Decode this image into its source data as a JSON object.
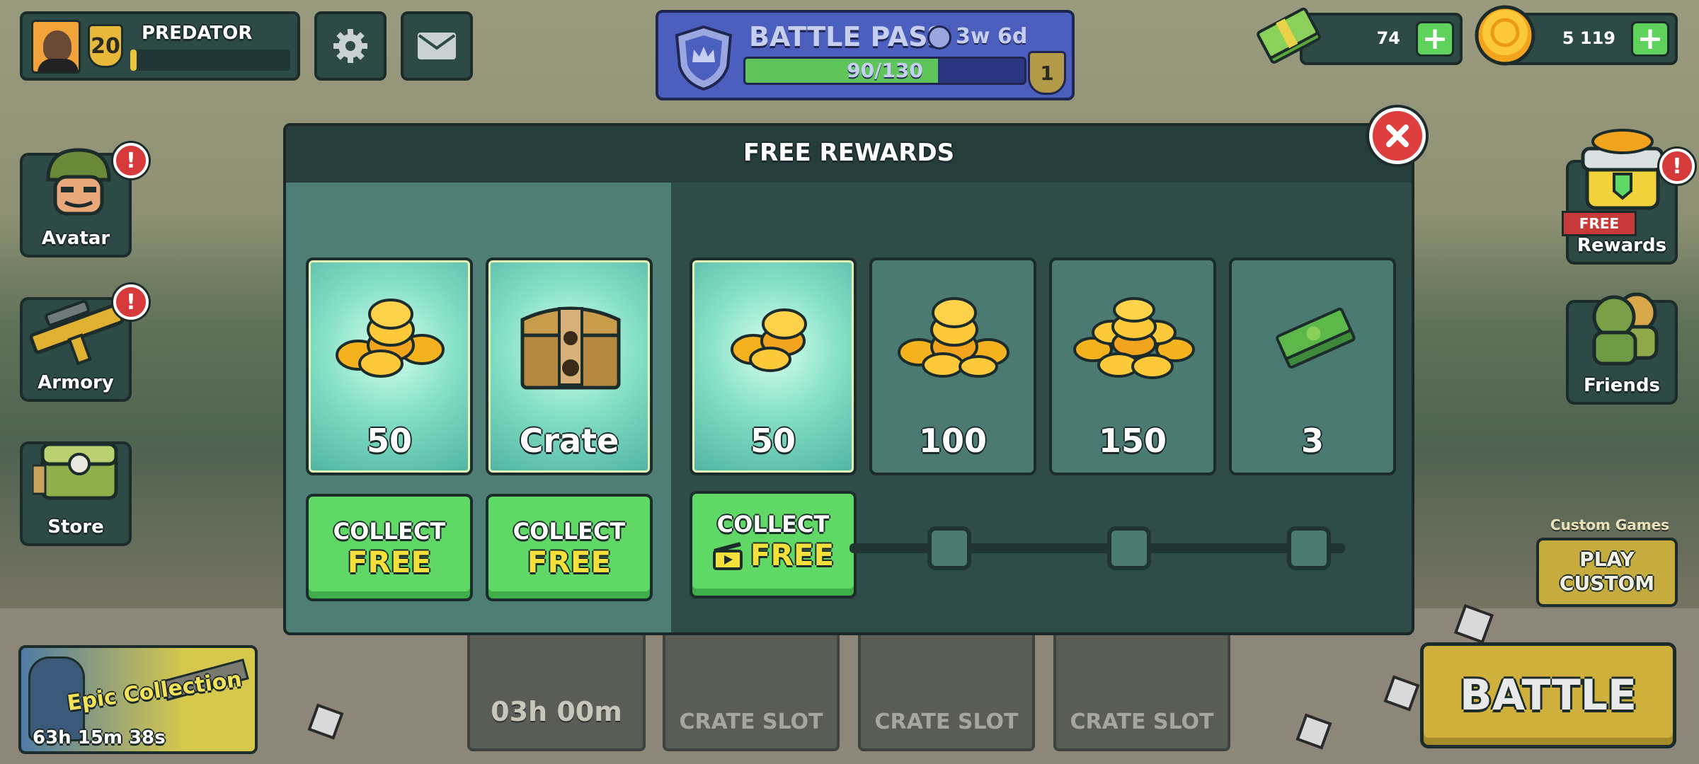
{
  "player": {
    "name": "PREDATOR",
    "level": "20",
    "xp_progress": 0.04
  },
  "battle_pass": {
    "title": "BATTLE PASS",
    "time_left": "3w 6d",
    "progress_text": "90/130",
    "progress": 0.69,
    "tier": "1"
  },
  "currency": {
    "cash": "74",
    "coins": "5 119"
  },
  "side_menu": {
    "avatar": "Avatar",
    "armory": "Armory",
    "store": "Store",
    "rewards": "Rewards",
    "rewards_badge": "FREE",
    "friends": "Friends"
  },
  "modal": {
    "title": "FREE REWARDS",
    "cards": [
      {
        "value": "50",
        "icon": "coins-icon"
      },
      {
        "value": "Crate",
        "icon": "crate-icon"
      },
      {
        "value": "50",
        "icon": "coins-icon"
      },
      {
        "value": "100",
        "icon": "coins-icon"
      },
      {
        "value": "150",
        "icon": "coins-icon"
      },
      {
        "value": "3",
        "icon": "cash-icon"
      }
    ],
    "collect_top": "COLLECT",
    "collect_free": "FREE"
  },
  "slots": {
    "timer": "03h 00m",
    "crate_slot": "CRATE SLOT"
  },
  "epic": {
    "title": "Epic Collection",
    "timer": "63h 15m 38s"
  },
  "custom": {
    "label": "Custom Games",
    "button": "PLAY CUSTOM"
  },
  "battle": {
    "label": "BATTLE"
  },
  "colors": {
    "panel": "#2d4a47",
    "green_button": "#5fd866",
    "accent_yellow": "#f3e03a",
    "battle_pass": "#4c5fbf",
    "close_red": "#df3e3e"
  }
}
